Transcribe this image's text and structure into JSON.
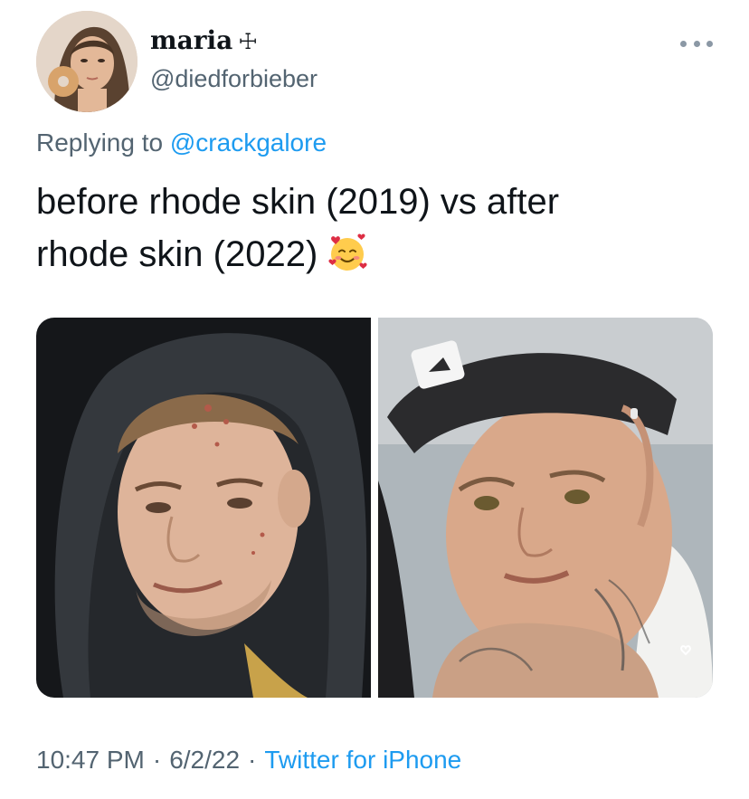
{
  "tweet": {
    "author": {
      "display_name": "maria",
      "name_symbol": "☩",
      "handle": "@diedforbieber"
    },
    "more_icon": "more-horizontal-icon",
    "reply_context": {
      "prefix": "Replying to",
      "mention": "@crackgalore"
    },
    "text_lines": [
      "before rhode skin (2019) vs after",
      "rhode skin (2022)"
    ],
    "emoji": "smiling-face-with-hearts",
    "media_count": 2,
    "timestamp": {
      "time": "10:47 PM",
      "date": "6/2/22",
      "separator": "·",
      "source": "Twitter for iPhone"
    }
  },
  "colors": {
    "text_primary": "#0f1419",
    "text_secondary": "#536471",
    "link": "#1d9bf0",
    "background": "#ffffff"
  }
}
